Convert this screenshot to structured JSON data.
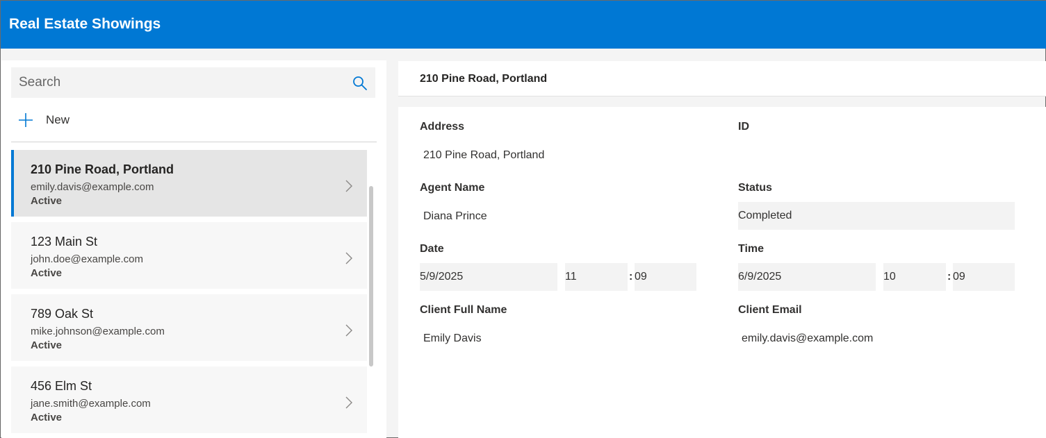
{
  "app": {
    "title": "Real Estate Showings"
  },
  "search": {
    "placeholder": "Search"
  },
  "new_button": {
    "label": "New"
  },
  "list": [
    {
      "address": "210 Pine Road, Portland",
      "email": "emily.davis@example.com",
      "status": "Active"
    },
    {
      "address": "123 Main St",
      "email": "john.doe@example.com",
      "status": "Active"
    },
    {
      "address": "789 Oak St",
      "email": "mike.johnson@example.com",
      "status": "Active"
    },
    {
      "address": "456 Elm St",
      "email": "jane.smith@example.com",
      "status": "Active"
    }
  ],
  "detail": {
    "header_title": "210 Pine Road, Portland",
    "labels": {
      "address": "Address",
      "id": "ID",
      "agent_name": "Agent Name",
      "status": "Status",
      "date": "Date",
      "time": "Time",
      "client_full_name": "Client Full Name",
      "client_email": "Client Email"
    },
    "values": {
      "address": "210 Pine Road, Portland",
      "id": "",
      "agent_name": "Diana Prince",
      "status": "Completed",
      "date": {
        "date": "5/9/2025",
        "hour": "11",
        "minute": "09"
      },
      "time": {
        "date": "6/9/2025",
        "hour": "10",
        "minute": "09"
      },
      "client_full_name": "Emily Davis",
      "client_email": "emily.davis@example.com"
    },
    "colon": ":"
  },
  "colors": {
    "accent": "#0078d4",
    "selected_bg": "#e5e5e5",
    "input_bg": "#f3f3f3"
  },
  "icons": {
    "search": "search-icon",
    "add": "plus-icon",
    "chevron": "chevron-right-icon"
  }
}
